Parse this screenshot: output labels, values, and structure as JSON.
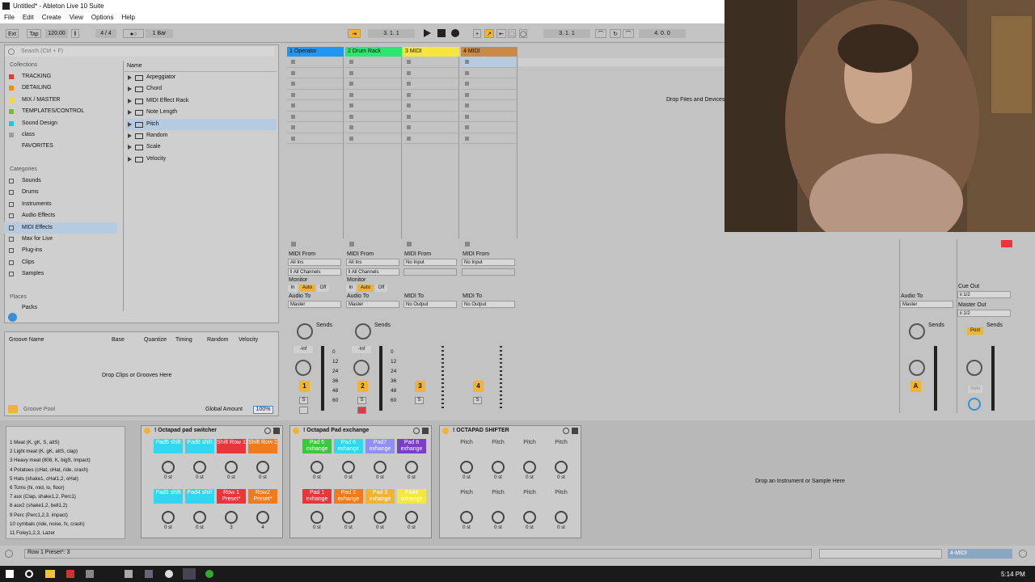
{
  "window": {
    "title": "Untitled* - Ableton Live 10 Suite"
  },
  "menu": [
    "File",
    "Edit",
    "Create",
    "View",
    "Options",
    "Help"
  ],
  "transport": {
    "ext": "Ext",
    "tap": "Tap",
    "tempo": "120.00",
    "signature": "4 / 4",
    "quantize": "1 Bar",
    "position": "3.   1.   1",
    "loop_start": "3.   1.   1",
    "loop_length": "4.   0.   0"
  },
  "browser": {
    "search_placeholder": "Search (Ctrl + F)",
    "collections_header": "Collections",
    "collections": [
      {
        "label": "TRACKING",
        "color": "#e53935"
      },
      {
        "label": "DETAILING",
        "color": "#fb8c00"
      },
      {
        "label": "MIX / MASTER",
        "color": "#fdd835"
      },
      {
        "label": "TEMPLATES/CONTROL",
        "color": "#7cb342"
      },
      {
        "label": "Sound Design",
        "color": "#26c6da"
      },
      {
        "label": "class",
        "color": "#9e9e9e"
      },
      {
        "label": "FAVORITES",
        "color": "#cfcfcf"
      }
    ],
    "categories_header": "Categories",
    "categories": [
      "Sounds",
      "Drums",
      "Instruments",
      "Audio Effects",
      "MIDI Effects",
      "Max for Live",
      "Plug-ins",
      "Clips",
      "Samples"
    ],
    "places_header": "Places",
    "places": [
      "Packs"
    ],
    "name_header": "Name",
    "items": [
      "Arpeggiator",
      "Chord",
      "MIDI Effect Rack",
      "Note Length",
      "Pitch",
      "Random",
      "Scale",
      "Velocity"
    ]
  },
  "groove": {
    "columns": [
      "Groove Name",
      "Base",
      "Quantize",
      "Timing",
      "Random",
      "Velocity"
    ],
    "empty": "Drop Clips or Grooves Here",
    "pool": "Groove Pool",
    "global_amount_label": "Global Amount",
    "global_amount": "100%"
  },
  "tracks": [
    {
      "name": "1 Operator",
      "color": "#2196f3",
      "num": "1",
      "input": "MIDI From",
      "from": "All Ins",
      "channel": "ǁ All Channels",
      "monitor": "Monitor",
      "mon": [
        "In",
        "Auto",
        "Off"
      ],
      "audio_to": "Audio To",
      "to": "Master",
      "sends": "Sends",
      "vol": "-Inf"
    },
    {
      "name": "2 Drum Rack",
      "color": "#2ee66b",
      "num": "2",
      "input": "MIDI From",
      "from": "All Ins",
      "channel": "ǁ All Channels",
      "monitor": "Monitor",
      "mon": [
        "In",
        "Auto",
        "Off"
      ],
      "audio_to": "Audio To",
      "to": "Master",
      "sends": "Sends",
      "vol": "-Inf"
    },
    {
      "name": "3 MIDI",
      "color": "#f5e642",
      "num": "3",
      "input": "MIDI From",
      "from": "No Input",
      "channel": "",
      "monitor": "",
      "mon": [],
      "audio_to": "MIDI To",
      "to": "No Output",
      "sends": "",
      "vol": ""
    },
    {
      "name": "4 MIDI",
      "color": "#c8894a",
      "num": "4",
      "input": "MIDI From",
      "from": "No Input",
      "channel": "",
      "monitor": "",
      "mon": [],
      "audio_to": "MIDI To",
      "to": "No Output",
      "sends": "",
      "vol": ""
    }
  ],
  "meter_ticks": [
    "0",
    "12",
    "24",
    "36",
    "48",
    "60"
  ],
  "drop_files": "Drop Files and Devices Here",
  "master": {
    "audio_to": "Audio To",
    "to": "Master",
    "sends": "Sends",
    "cue_out": "Cue Out",
    "cue_val": "ii 1/2",
    "master_out": "Master Out",
    "master_val": "ii 1/2",
    "post": "Post",
    "solo": "Solo",
    "return_label": "A"
  },
  "chain_list": [
    "1 Meat (K, gK, S, altS)",
    "2 Light meat (K, gK, altS, clap)",
    "3 Heavy meat (808, K, bigS, Impact)",
    "4 Potatoes (cHat, oHat, ride, crash)",
    "5 Hats (shake1, cHat1,2, oHat)",
    "6 Toms (hi, mid, lo, floor)",
    "7 aux (Clap, shake1,2, Perc1)",
    "8 aux2 (shake1,2, bell1,2)",
    "9 Perc (Perc1,2,3, impact)",
    "10 cymbals (ride, noise, fx, crash)",
    "11 Foley1,2,3, Lazer"
  ],
  "racks": [
    {
      "title": "! Octapad pad switcher",
      "pads": [
        {
          "l": "Pad5 shift",
          "c": "#33d6f0"
        },
        {
          "l": "Pad8 shift",
          "c": "#33d6f0"
        },
        {
          "l": "Shift Row 1",
          "c": "#e8373a"
        },
        {
          "l": "Shift Row 2",
          "c": "#f07a1e"
        },
        {
          "l": "Pad1 shift",
          "c": "#33d6f0"
        },
        {
          "l": "Pad4 shift",
          "c": "#33d6f0"
        },
        {
          "l": "Row 1 Preset*",
          "c": "#e8373a"
        },
        {
          "l": "Row2 Preset*",
          "c": "#f07a1e"
        }
      ],
      "vals": [
        "0 st",
        "0 st",
        "0 st",
        "0 st",
        "0 st",
        "0 st",
        "3",
        "4"
      ]
    },
    {
      "title": "! Octapad Pad exchange",
      "pads": [
        {
          "l": "Pad 5 exhange",
          "c": "#3cc83c"
        },
        {
          "l": "Pad 6 exhange",
          "c": "#33d6f0"
        },
        {
          "l": "Pad7 exhange",
          "c": "#8f8ff5"
        },
        {
          "l": "Pad 8 exhange",
          "c": "#7a3ec8"
        },
        {
          "l": "Pad 1 exhange",
          "c": "#e8373a"
        },
        {
          "l": "Pad 2 exhange",
          "c": "#f07a1e"
        },
        {
          "l": "Pad 3 exhange",
          "c": "#f0b334"
        },
        {
          "l": "Pad4 exhange",
          "c": "#f5e642"
        }
      ],
      "vals": [
        "0 st",
        "0 st",
        "0 st",
        "0 st",
        "0 st",
        "0 st",
        "0 st",
        "0 st"
      ]
    },
    {
      "title": "! OCTAPAD SHIFTER",
      "pads": [
        {
          "l": "Pitch",
          "c": "#cbcbcb"
        },
        {
          "l": "Pitch",
          "c": "#cbcbcb"
        },
        {
          "l": "Pitch",
          "c": "#cbcbcb"
        },
        {
          "l": "Pitch",
          "c": "#cbcbcb"
        },
        {
          "l": "Pitch",
          "c": "#cbcbcb"
        },
        {
          "l": "Pitch",
          "c": "#cbcbcb"
        },
        {
          "l": "Pitch",
          "c": "#cbcbcb"
        },
        {
          "l": "Pitch",
          "c": "#cbcbcb"
        }
      ],
      "vals": [
        "0 st",
        "0 st",
        "0 st",
        "0 st",
        "0 st",
        "0 st",
        "0 st",
        "0 st"
      ]
    }
  ],
  "drop_instrument": "Drop an Instrument or Sample Here",
  "status": {
    "text": "Row 1 Preset*: 3",
    "track": "4-MIDI"
  },
  "taskbar": {
    "time": "5:14 PM"
  }
}
